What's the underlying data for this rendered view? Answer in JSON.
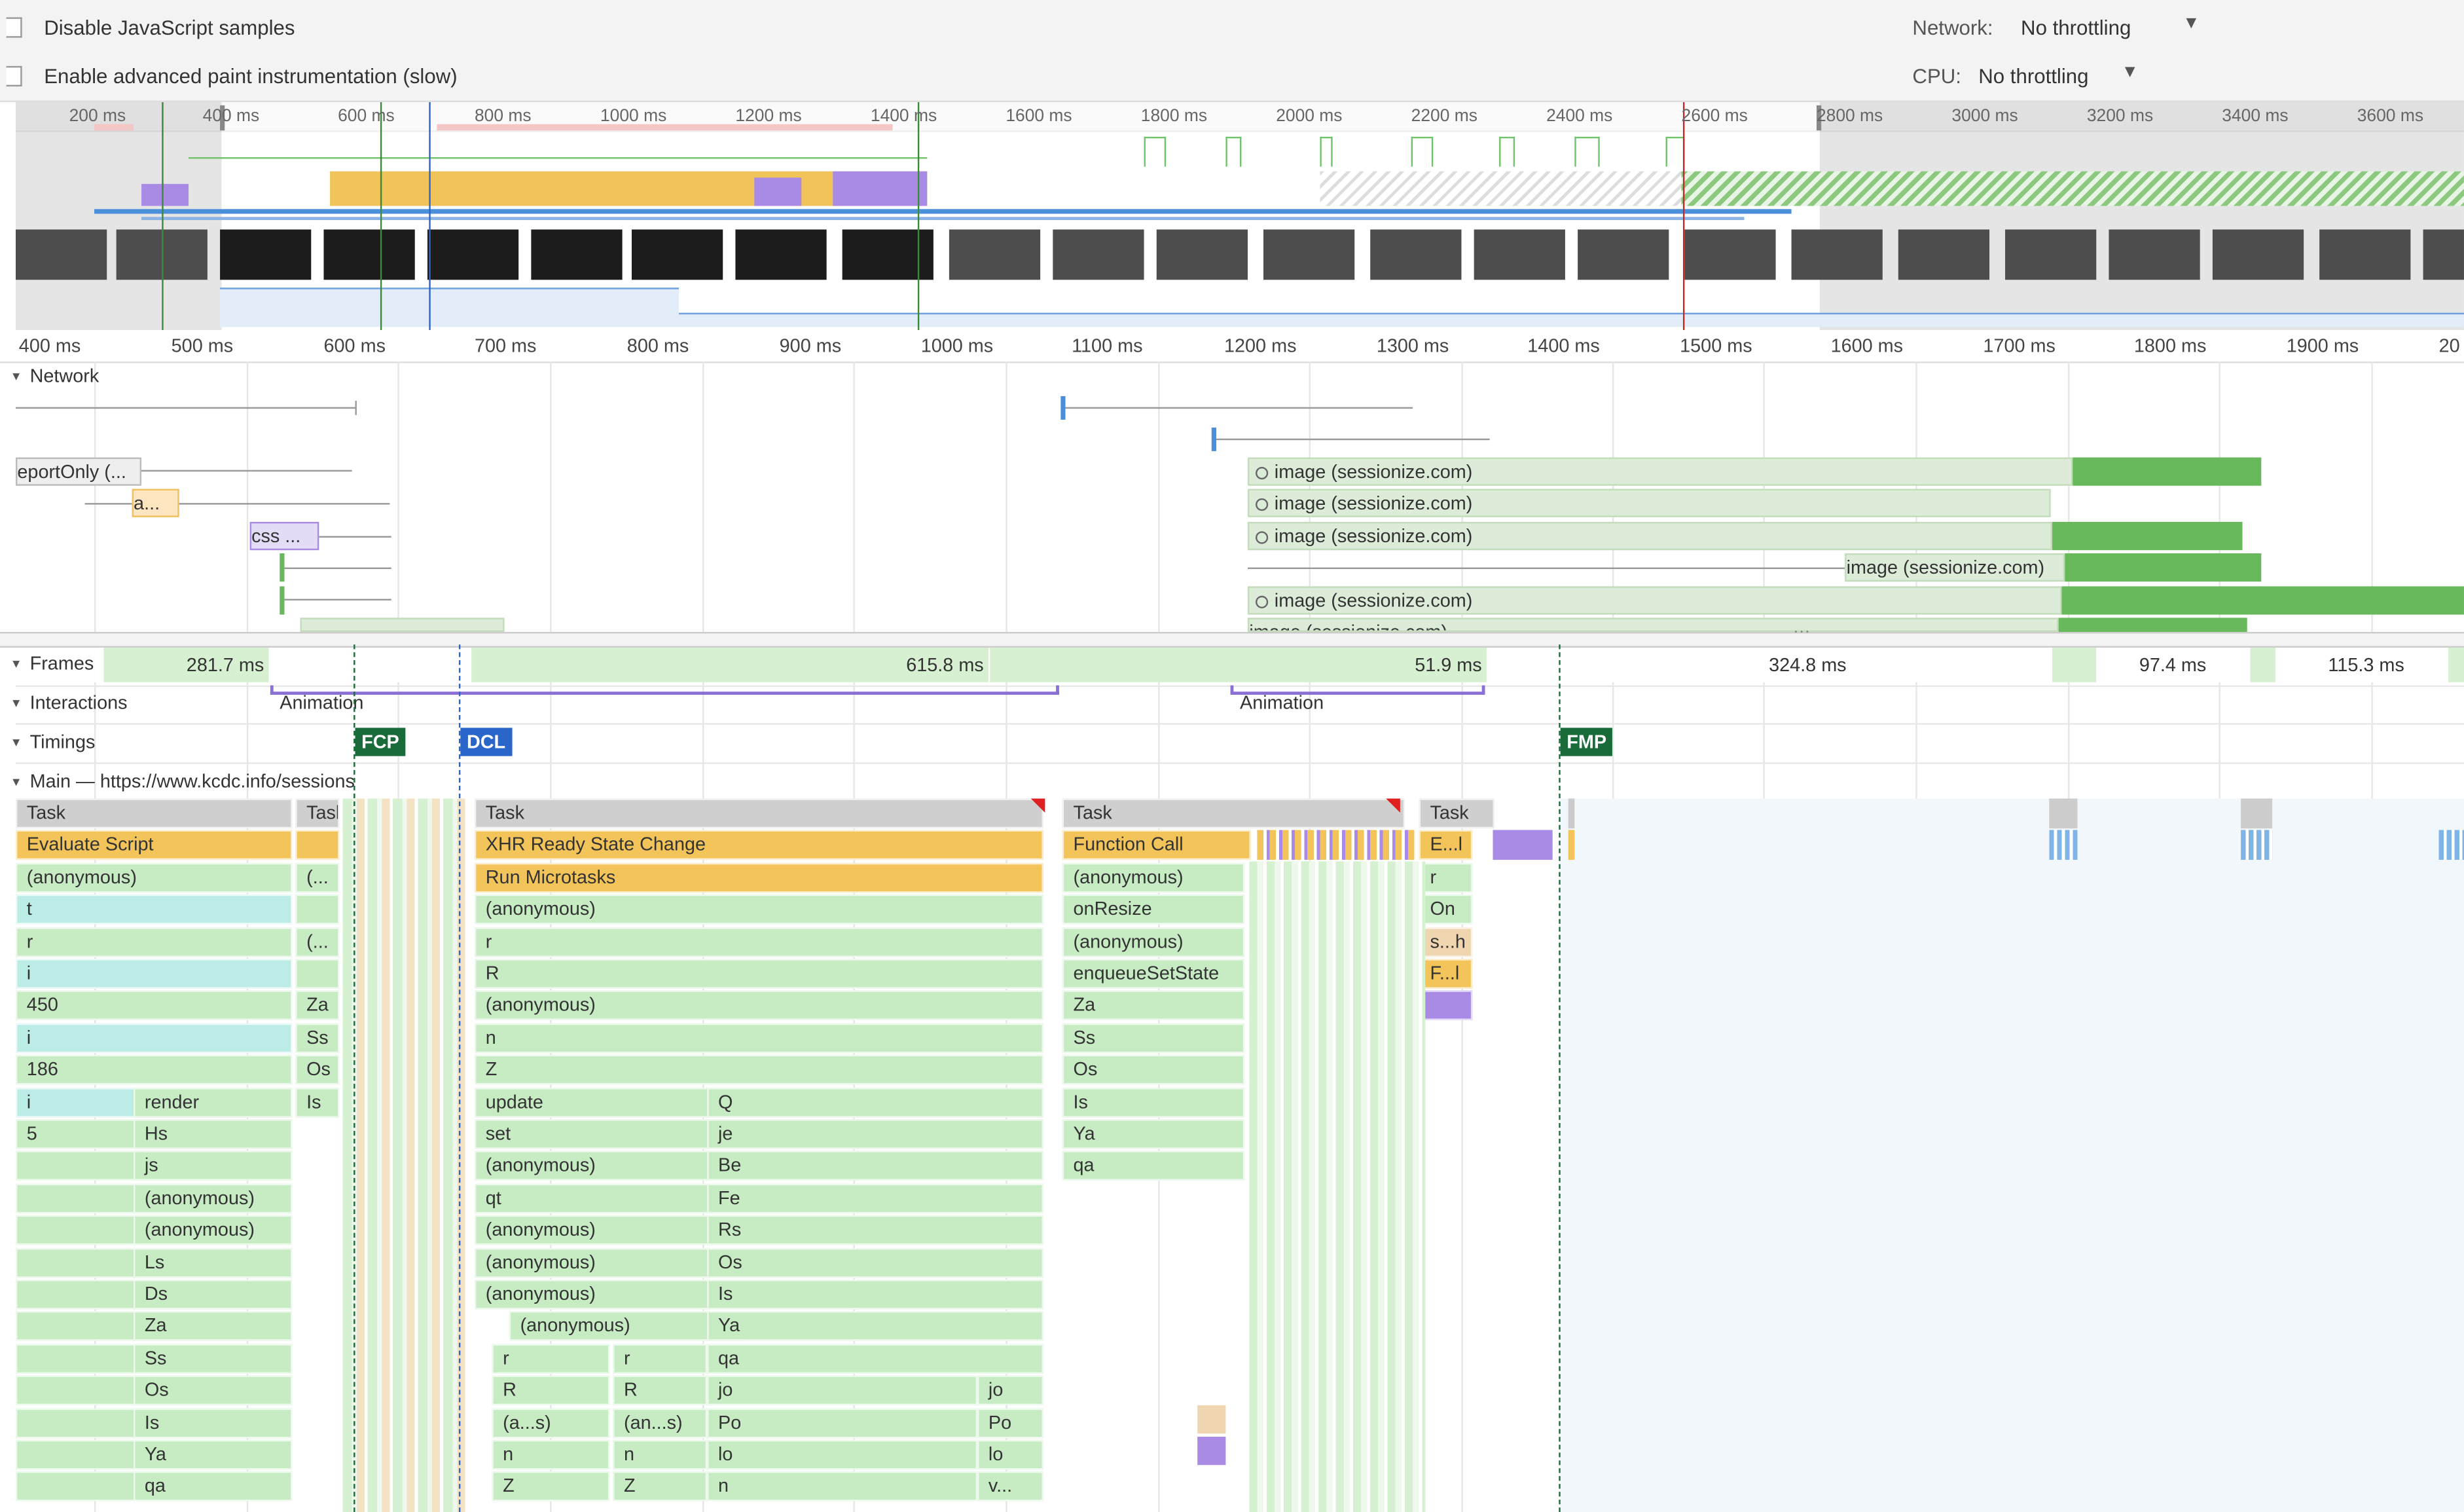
{
  "settings": {
    "disable_js_samples": "Disable JavaScript samples",
    "advanced_paint": "Enable advanced paint instrumentation (slow)",
    "network_label": "Network:",
    "network_value": "No throttling",
    "cpu_label": "CPU:",
    "cpu_value": "No throttling"
  },
  "overview_ticks": [
    "200 ms",
    "400 ms",
    "600 ms",
    "800 ms",
    "1000 ms",
    "1200 ms",
    "1400 ms",
    "1600 ms",
    "1800 ms",
    "2000 ms",
    "2200 ms",
    "2400 ms",
    "2600 ms",
    "2800 ms",
    "3000 ms",
    "3200 ms",
    "3400 ms",
    "3600 ms"
  ],
  "ruler_ticks": [
    "400 ms",
    "500 ms",
    "600 ms",
    "700 ms",
    "800 ms",
    "900 ms",
    "1000 ms",
    "1100 ms",
    "1200 ms",
    "1300 ms",
    "1400 ms",
    "1500 ms",
    "1600 ms",
    "1700 ms",
    "1800 ms",
    "1900 ms",
    "20"
  ],
  "tracks": {
    "network": "Network",
    "frames": "Frames",
    "interactions": "Interactions",
    "timings": "Timings",
    "main": "Main — https://www.kcdc.info/sessions"
  },
  "network": {
    "req_report": "eportOnly (...",
    "req_a": "a...",
    "req_css": "css ...",
    "req_bottom": "...",
    "image_label": "image (sessionize.com)",
    "image_bottom": "image (sessionize.com)"
  },
  "frames": [
    "281.7 ms",
    "615.8 ms",
    "51.9 ms",
    "324.8 ms",
    "97.4 ms",
    "115.3 ms"
  ],
  "interactions": [
    "Animation",
    "Animation"
  ],
  "timings": {
    "fcp": "FCP",
    "dcl": "DCL",
    "fmp": "FMP"
  },
  "flame": {
    "col1": [
      "Task",
      "Evaluate Script",
      "(anonymous)",
      "t",
      "r",
      "i",
      "450",
      "i",
      "186",
      "i",
      "5",
      "",
      "",
      "",
      "",
      "",
      "",
      "",
      "",
      "",
      "",
      ""
    ],
    "col1b": [
      "render",
      "Hs",
      "js",
      "(anonymous)",
      "(anonymous)",
      "Ls",
      "Ds",
      "Za",
      "Ss",
      "Os",
      "Is",
      "Ya",
      "qa"
    ],
    "col2": [
      "Task",
      "",
      "(...",
      "",
      "(...",
      "",
      "Za",
      "Ss",
      "Os",
      "Is"
    ],
    "col3": [
      "Task",
      "XHR Ready State Change",
      "Run Microtasks",
      "(anonymous)",
      "r",
      "R",
      "(anonymous)",
      "n",
      "Z",
      "update",
      "set",
      "(anonymous)",
      "qt",
      "(anonymous)",
      "(anonymous)",
      "(anonymous)",
      "(anonymous)",
      "r",
      "R",
      "(a...s)",
      "n",
      "Z"
    ],
    "col3b": [
      "Q",
      "je",
      "Be",
      "Fe",
      "Rs",
      "Os",
      "Is",
      "Ya",
      "qa",
      "jo",
      "Po",
      "lo",
      "n"
    ],
    "col3c": [
      "r",
      "R",
      "(an...s)",
      "n",
      "Z"
    ],
    "col3d": [
      "jo",
      "Po",
      "lo",
      "v..."
    ],
    "col4": [
      "Task",
      "Function Call",
      "(anonymous)",
      "onResize",
      "(anonymous)",
      "enqueueSetState",
      "Za",
      "Ss",
      "Os",
      "Is",
      "Ya",
      "qa"
    ],
    "col5": [
      "Task",
      "E...l",
      "r",
      "On",
      "s...h",
      "F...l"
    ]
  }
}
